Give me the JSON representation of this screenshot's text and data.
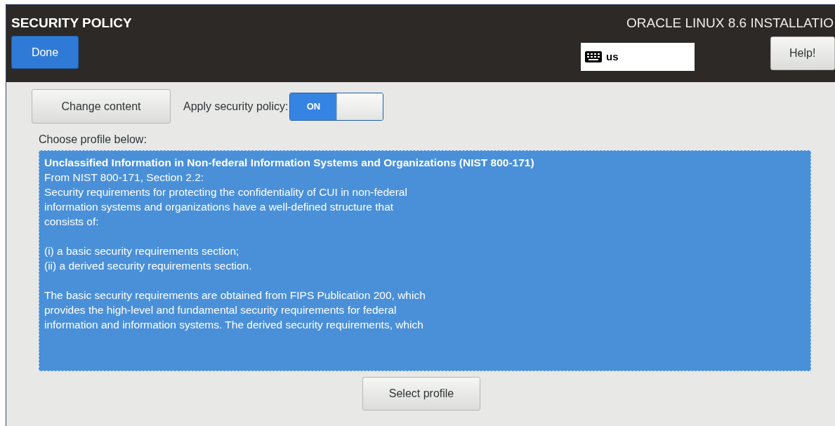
{
  "header": {
    "title": "SECURITY POLICY",
    "done_button": "Done",
    "product_title": "ORACLE LINUX 8.6 INSTALLATIO",
    "keyboard_layout": "us",
    "help_button": "Help!"
  },
  "content_button": "Change content",
  "apply_policy": {
    "label": "Apply security policy:",
    "switch_text": "ON",
    "on": true
  },
  "profile_prompt": "Choose profile below:",
  "profiles": [
    {
      "title": "Unclassified Information in Non-federal Information Systems and Organizations (NIST 800-171)",
      "selected": true,
      "paragraphs": [
        [
          "From NIST 800-171, Section 2.2:",
          "Security requirements for protecting the confidentiality of CUI in non-federal",
          "information systems and organizations have a well-defined structure that",
          "consists of:"
        ],
        [
          "(i) a basic security requirements section;",
          "(ii) a derived security requirements section."
        ],
        [
          "The basic security requirements are obtained from FIPS Publication 200, which",
          "provides the high-level and fundamental security requirements for federal",
          "information and information systems. The derived security requirements, which"
        ]
      ]
    }
  ],
  "select_button": "Select profile"
}
